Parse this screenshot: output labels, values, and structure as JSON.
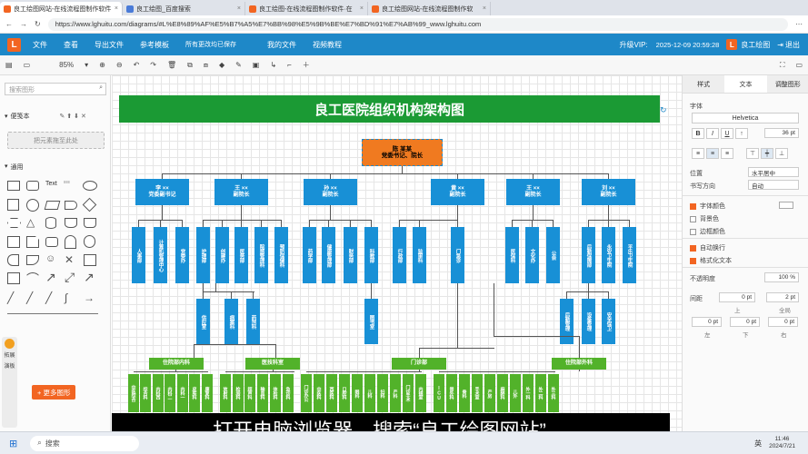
{
  "browser": {
    "tabs": [
      {
        "title": "良工绘图网站-在线流程图制作软件"
      },
      {
        "title": "良工绘图_百度搜索"
      },
      {
        "title": "良工绘图-在线流程图制作软件·在"
      },
      {
        "title": "良工绘图网站-在线流程图制作软"
      }
    ],
    "url": "https://www.lghuitu.com/diagrams/#L%E8%89%AF%E5%B7%A5%E7%BB%98%E5%9B%BE%E7%BD%91%E7%AB%99_www.lghuitu.com"
  },
  "menubar": {
    "items": [
      "文件",
      "查看",
      "导出文件",
      "参考模板",
      "所有更改均已保存",
      "我的文件",
      "视频教程"
    ],
    "vip": "升级VIP:",
    "datetime": "2025-12-09 20:59:28",
    "brand": "良工绘图",
    "logout": "退出"
  },
  "toolbar": {
    "zoom": "85%"
  },
  "leftpanel": {
    "search_placeholder": "搜索图形",
    "section_sticky": "便笺本",
    "drop_hint": "把元素拖至此处",
    "section_general": "通用",
    "more_button": "+ 更多图形",
    "float_items": [
      "拓展",
      "演板"
    ]
  },
  "diagram": {
    "title": "良工医院组织机构架构图",
    "top_box": "陈 某某\n党委书记、院长",
    "leaders": [
      "李 ××\n党委副书记",
      "王 ××\n副院长",
      "孙 ××\n副院长",
      "黄 ××\n副院长",
      "王 ××\n副院长",
      "刘 ××\n副院长"
    ],
    "depts": [
      "人事部",
      "计算机管理中心",
      "党委办",
      "护理部",
      "创建办",
      "医务部",
      "院感管理科",
      "预防保健科",
      "药学部",
      "健康管理部",
      "财务部",
      "科教部",
      "行政部",
      "监审科",
      "门急诊",
      "医保科",
      "文化办",
      "公会",
      "后勤保障部",
      "永安卫生院",
      "平乐卫生院"
    ],
    "subdepts": [
      "供应室",
      "病案科",
      "药剂科",
      "图书室",
      "后勤管理",
      "设备管理",
      "安全保卫"
    ],
    "groups": [
      "住院部内科",
      "医技科室",
      "门诊部",
      "住院部外科"
    ],
    "bottom": [
      "中医综合",
      "综合科",
      "内科西",
      "内科二",
      "内科一",
      "皮肤科",
      "康复科",
      "放射科",
      "检验科",
      "超声科",
      "输血科",
      "体检科",
      "急诊科",
      "门诊办公",
      "中医科",
      "西医科",
      "口腔科",
      "眼科",
      "儿科",
      "妇科",
      "产科",
      "门诊手术",
      "内镜室",
      "ICU",
      "普外科",
      "骨科",
      "手术室",
      "产房",
      "麻醉科",
      "儿外",
      "外一科",
      "外二科",
      "外三科"
    ]
  },
  "rightpanel": {
    "tabs": [
      "样式",
      "文本",
      "调整图形"
    ],
    "font_label": "字体",
    "font": "Helvetica",
    "font_size": "36 pt",
    "position_label": "位置",
    "position_value": "水平居中",
    "direction_label": "书写方向",
    "direction_value": "自动",
    "checks": [
      {
        "label": "字体颜色",
        "on": true
      },
      {
        "label": "背景色",
        "on": false
      },
      {
        "label": "边框颜色",
        "on": false
      },
      {
        "label": "自动换行",
        "on": true
      },
      {
        "label": "格式化文本",
        "on": true
      }
    ],
    "opacity_label": "不透明度",
    "opacity": "100 %",
    "spacing_label": "间距",
    "spacing_top": "0 pt",
    "spacing_global": "2 pt",
    "spacing_top_label": "上",
    "spacing_global_label": "全局",
    "spacing_left": "0 pt",
    "spacing_bottom": "0 pt",
    "spacing_right": "0 pt",
    "spacing_left_label": "左",
    "spacing_bottom_label": "下",
    "spacing_right_label": "右"
  },
  "subtitle": "打开电脑浏览器，搜索“良工绘图网站”。",
  "taskbar": {
    "search": "搜索",
    "time": "11:46",
    "date": "2024/7/21",
    "lang": "英"
  }
}
